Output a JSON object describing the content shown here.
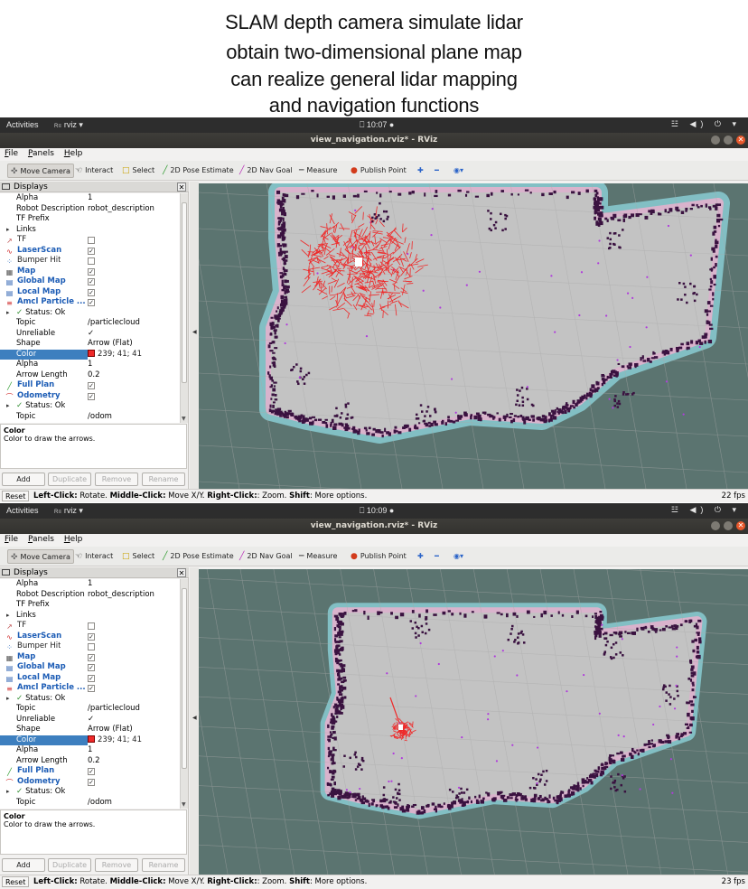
{
  "caption": {
    "line1": "SLAM depth camera   simulate lidar",
    "line2": "obtain  two-dimensional plane map",
    "line3": "can realize general lidar mapping",
    "line4": "and navigation functions"
  },
  "shots": [
    {
      "topbar": {
        "activities": "Activities",
        "app": "rviz ▾",
        "clock": "⎕ 10:07 ●",
        "tray": "☳ ◀) ⏻ ▾"
      },
      "window_title": "view_navigation.rviz* - RViz",
      "menu": [
        "File",
        "Panels",
        "Help"
      ],
      "tools": [
        "Move Camera",
        "Interact",
        "Select",
        "2D Pose Estimate",
        "2D Nav Goal",
        "Measure",
        "Publish Point"
      ],
      "panel_title": "Displays",
      "rows": [
        {
          "label": "Alpha",
          "value": "1"
        },
        {
          "label": "Robot Description",
          "value": "robot_description"
        },
        {
          "label": "TF Prefix",
          "value": ""
        },
        {
          "label": "Links",
          "value": ""
        },
        {
          "label": "TF",
          "value": ""
        },
        {
          "label": "LaserScan",
          "value": ""
        },
        {
          "label": "Bumper Hit",
          "value": ""
        },
        {
          "label": "Map",
          "value": ""
        },
        {
          "label": "Global Map",
          "value": ""
        },
        {
          "label": "Local Map",
          "value": ""
        },
        {
          "label": "Amcl Particle ...",
          "value": ""
        },
        {
          "label": "Status: Ok",
          "value": ""
        },
        {
          "label": "Topic",
          "value": "/particlecloud"
        },
        {
          "label": "Unreliable",
          "value": ""
        },
        {
          "label": "Shape",
          "value": "Arrow (Flat)"
        },
        {
          "label": "Color",
          "value": "239; 41; 41"
        },
        {
          "label": "Alpha",
          "value": "1"
        },
        {
          "label": "Arrow Length",
          "value": "0.2"
        },
        {
          "label": "Full Plan",
          "value": ""
        },
        {
          "label": "Odometry",
          "value": ""
        },
        {
          "label": "Status: Ok",
          "value": ""
        },
        {
          "label": "Topic",
          "value": "/odom"
        }
      ],
      "desc_title": "Color",
      "desc_text": "Color to draw the arrows.",
      "buttons": [
        "Add",
        "Duplicate",
        "Remove",
        "Rename"
      ],
      "reset": "Reset",
      "hint_parts": [
        "Left-Click:",
        " Rotate. ",
        "Middle-Click:",
        " Move X/Y. ",
        "Right-Click:",
        ": Zoom. ",
        "Shift",
        ": More options."
      ],
      "fps": "22 fps"
    },
    {
      "topbar": {
        "activities": "Activities",
        "app": "rviz ▾",
        "clock": "⎕ 10:09 ●",
        "tray": "☳ ◀) ⏻ ▾"
      },
      "window_title": "view_navigation.rviz* - RViz",
      "menu": [
        "File",
        "Panels",
        "Help"
      ],
      "tools": [
        "Move Camera",
        "Interact",
        "Select",
        "2D Pose Estimate",
        "2D Nav Goal",
        "Measure",
        "Publish Point"
      ],
      "panel_title": "Displays",
      "rows": [
        {
          "label": "Alpha",
          "value": "1"
        },
        {
          "label": "Robot Description",
          "value": "robot_description"
        },
        {
          "label": "TF Prefix",
          "value": ""
        },
        {
          "label": "Links",
          "value": ""
        },
        {
          "label": "TF",
          "value": ""
        },
        {
          "label": "LaserScan",
          "value": ""
        },
        {
          "label": "Bumper Hit",
          "value": ""
        },
        {
          "label": "Map",
          "value": ""
        },
        {
          "label": "Global Map",
          "value": ""
        },
        {
          "label": "Local Map",
          "value": ""
        },
        {
          "label": "Amcl Particle ...",
          "value": ""
        },
        {
          "label": "Status: Ok",
          "value": ""
        },
        {
          "label": "Topic",
          "value": "/particlecloud"
        },
        {
          "label": "Unreliable",
          "value": ""
        },
        {
          "label": "Shape",
          "value": "Arrow (Flat)"
        },
        {
          "label": "Color",
          "value": "239; 41; 41"
        },
        {
          "label": "Alpha",
          "value": "1"
        },
        {
          "label": "Arrow Length",
          "value": "0.2"
        },
        {
          "label": "Full Plan",
          "value": ""
        },
        {
          "label": "Odometry",
          "value": ""
        },
        {
          "label": "Status: Ok",
          "value": ""
        },
        {
          "label": "Topic",
          "value": "/odom"
        }
      ],
      "desc_title": "Color",
      "desc_text": "Color to draw the arrows.",
      "buttons": [
        "Add",
        "Duplicate",
        "Remove",
        "Rename"
      ],
      "reset": "Reset",
      "hint_parts": [
        "Left-Click:",
        " Rotate. ",
        "Middle-Click:",
        " Move X/Y. ",
        "Right-Click:",
        ": Zoom. ",
        "Shift",
        ": More options."
      ],
      "fps": "23 fps"
    }
  ],
  "colors": {
    "viewport_bg": "#5b7470",
    "map_floor": "#c3c3c3",
    "inflation_cyan": "#8fd8e0",
    "inflation_pink": "#d9b3cc",
    "obstacle": "#3a1240",
    "particles": "#ef2929",
    "selection": "#3d7fbf"
  }
}
